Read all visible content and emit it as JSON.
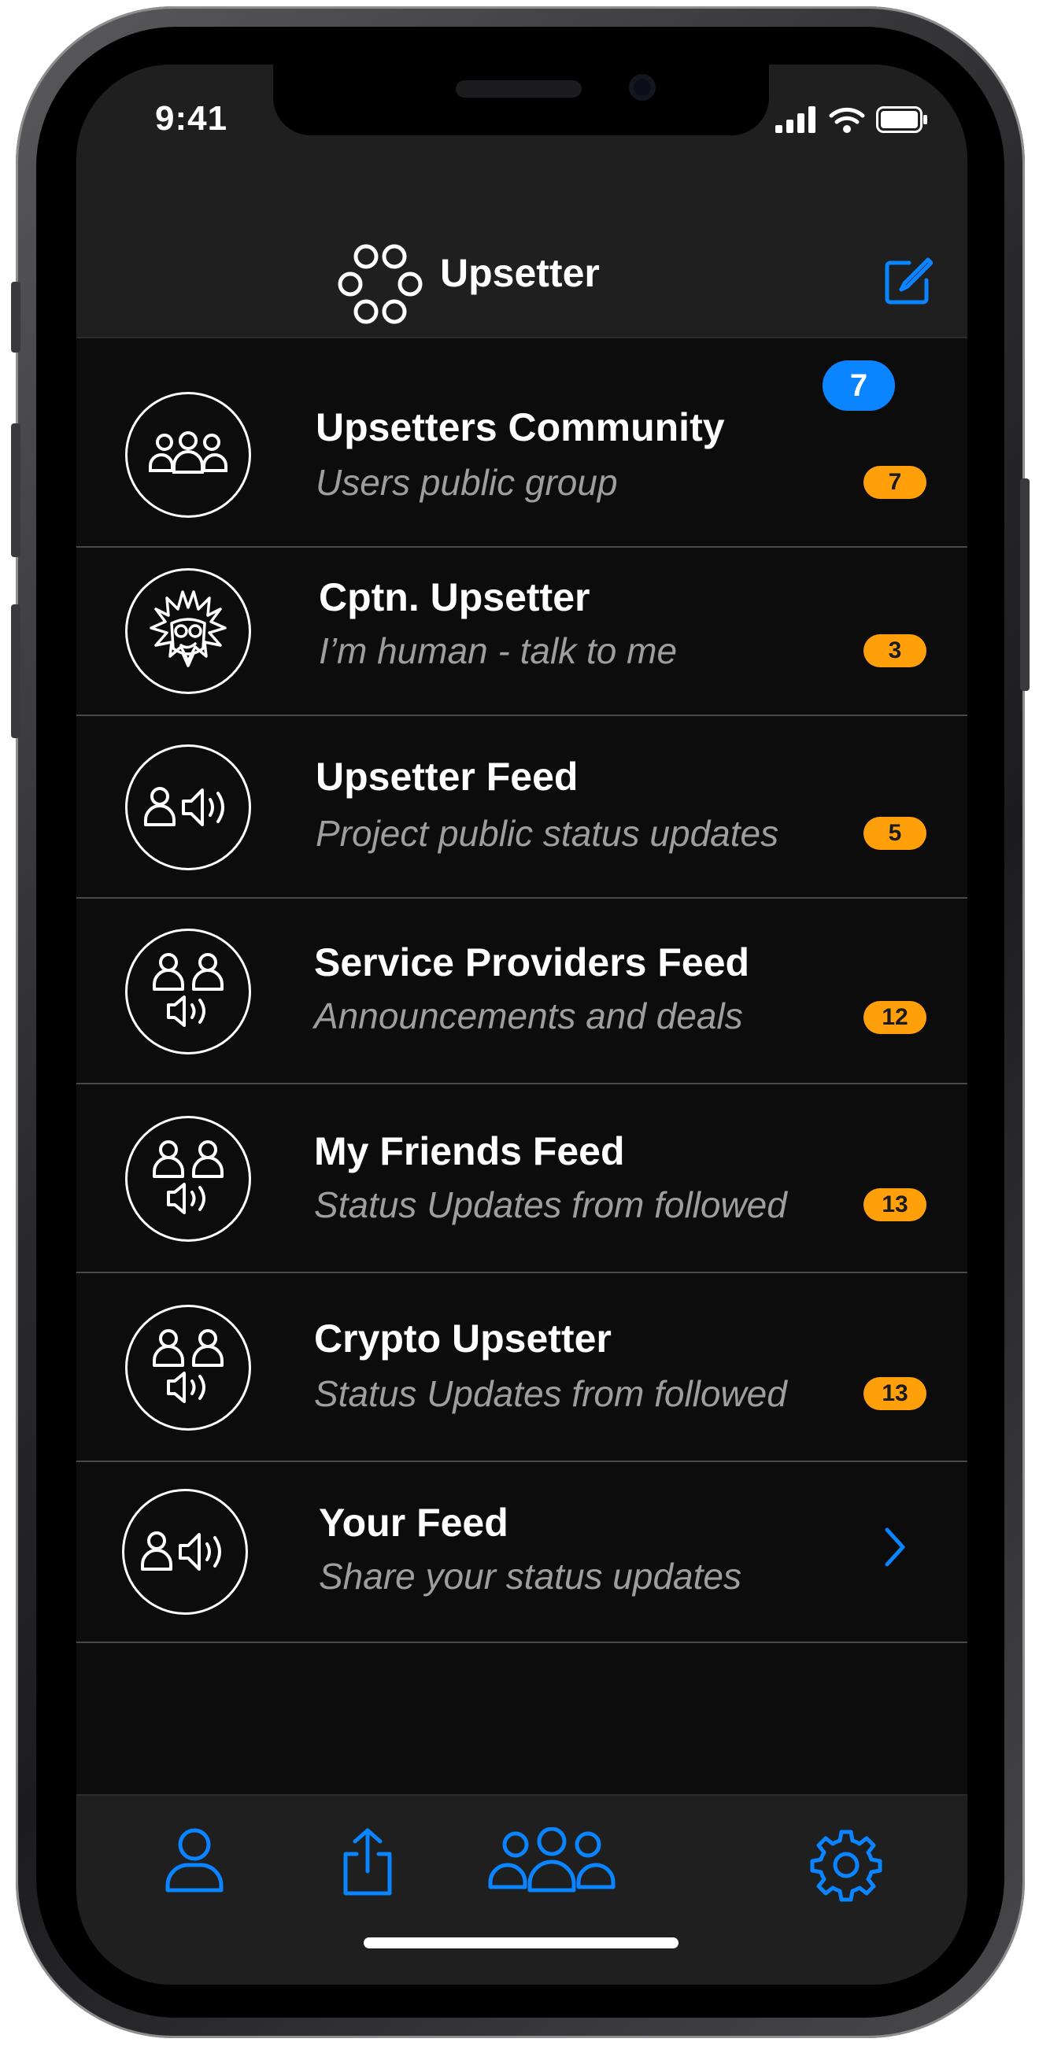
{
  "status_bar": {
    "time": "9:41"
  },
  "header": {
    "title": "Upsetter",
    "compose_icon": "compose-icon",
    "logo_icon": "rings-logo-icon"
  },
  "list": {
    "items": [
      {
        "title": "Upsetters Community",
        "subtitle": "Users public group",
        "badge": "7",
        "top_badge": "7",
        "icon": "community-group-icon"
      },
      {
        "title": "Cptn. Upsetter",
        "subtitle": "I’m human - talk to me",
        "badge": "3",
        "icon": "captain-face-icon"
      },
      {
        "title": "Upsetter Feed",
        "subtitle": "Project public status updates",
        "badge": "5",
        "icon": "person-speaker-icon"
      },
      {
        "title": "Service Providers Feed",
        "subtitle": "Announcements and deals",
        "badge": "12",
        "icon": "people-speaker-icon"
      },
      {
        "title": "My Friends Feed",
        "subtitle": "Status Updates from followed",
        "badge": "13",
        "icon": "people-speaker-icon"
      },
      {
        "title": "Crypto Upsetter",
        "subtitle": "Status Updates from followed",
        "badge": "13",
        "icon": "people-speaker-icon"
      },
      {
        "title": "Your Feed",
        "subtitle": "Share your status updates",
        "icon": "person-speaker-icon",
        "accessory": "chevron-right-icon"
      }
    ]
  },
  "tab_bar": {
    "tabs": [
      {
        "icon": "profile-icon"
      },
      {
        "icon": "share-icon"
      },
      {
        "icon": "group-icon"
      },
      {
        "icon": "settings-gear-icon"
      }
    ]
  },
  "colors": {
    "accent": "#0a84ff",
    "badge": "#ff9f0a",
    "background": "#0c0c0c",
    "bar": "#1f1f1f"
  }
}
